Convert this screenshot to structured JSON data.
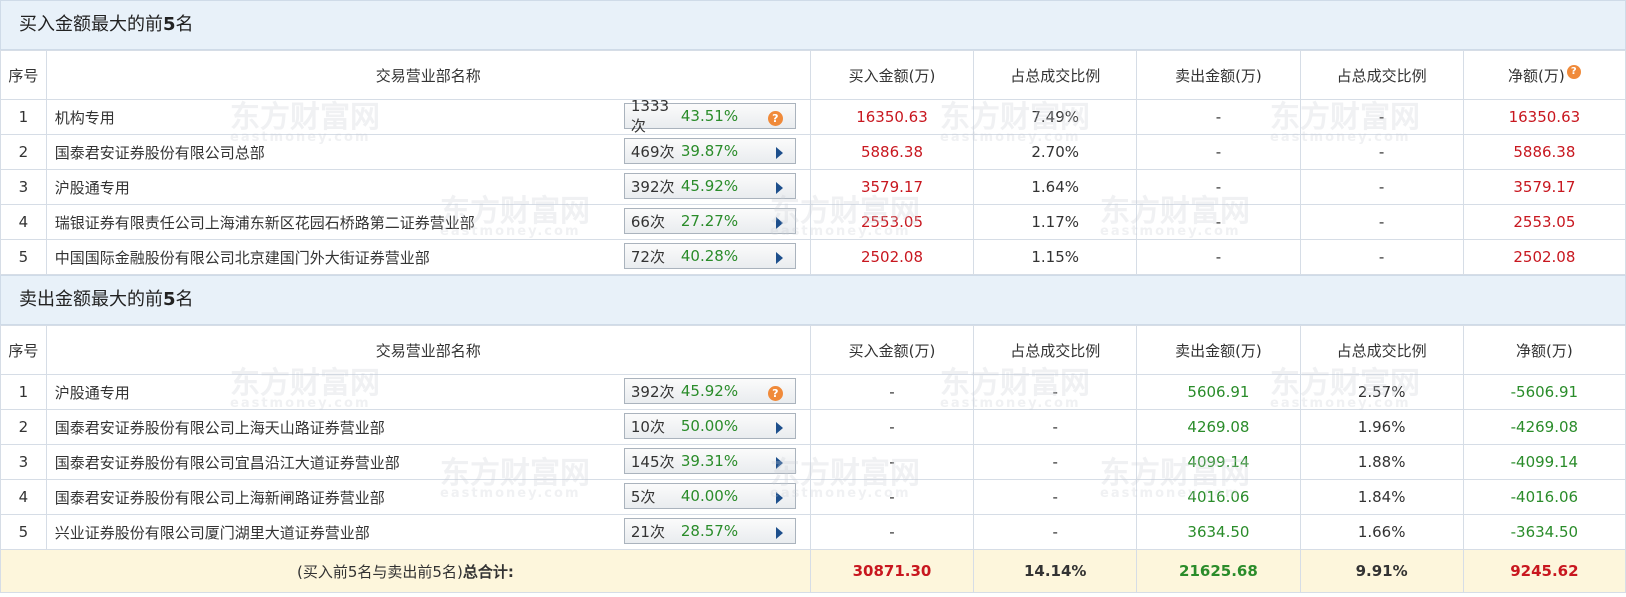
{
  "buy_section": {
    "title_prefix": "买入金额最大的前",
    "title_num": "5",
    "title_suffix": "名",
    "headers": [
      "序号",
      "交易营业部名称",
      "买入金额(万)",
      "占总成交比例",
      "卖出金额(万)",
      "占总成交比例",
      "净额(万)"
    ],
    "rows": [
      {
        "idx": "1",
        "name": "机构专用",
        "count": "1333次",
        "pct": "43.51%",
        "icon": "question-icon",
        "buy": "16350.63",
        "buy_ratio": "7.49%",
        "sell": "-",
        "sell_ratio": "-",
        "net": "16350.63"
      },
      {
        "idx": "2",
        "name": "国泰君安证券股份有限公司总部",
        "count": "469次",
        "pct": "39.87%",
        "icon": "arrow-right-icon",
        "buy": "5886.38",
        "buy_ratio": "2.70%",
        "sell": "-",
        "sell_ratio": "-",
        "net": "5886.38"
      },
      {
        "idx": "3",
        "name": "沪股通专用",
        "count": "392次",
        "pct": "45.92%",
        "icon": "arrow-right-icon",
        "buy": "3579.17",
        "buy_ratio": "1.64%",
        "sell": "-",
        "sell_ratio": "-",
        "net": "3579.17"
      },
      {
        "idx": "4",
        "name": "瑞银证券有限责任公司上海浦东新区花园石桥路第二证券营业部",
        "count": "66次",
        "pct": "27.27%",
        "icon": "arrow-right-icon",
        "buy": "2553.05",
        "buy_ratio": "1.17%",
        "sell": "-",
        "sell_ratio": "-",
        "net": "2553.05"
      },
      {
        "idx": "5",
        "name": "中国国际金融股份有限公司北京建国门外大街证券营业部",
        "count": "72次",
        "pct": "40.28%",
        "icon": "arrow-right-icon",
        "buy": "2502.08",
        "buy_ratio": "1.15%",
        "sell": "-",
        "sell_ratio": "-",
        "net": "2502.08"
      }
    ]
  },
  "sell_section": {
    "title_prefix": "卖出金额最大的前",
    "title_num": "5",
    "title_suffix": "名",
    "headers": [
      "序号",
      "交易营业部名称",
      "买入金额(万)",
      "占总成交比例",
      "卖出金额(万)",
      "占总成交比例",
      "净额(万)"
    ],
    "rows": [
      {
        "idx": "1",
        "name": "沪股通专用",
        "count": "392次",
        "pct": "45.92%",
        "icon": "question-icon",
        "buy": "-",
        "buy_ratio": "-",
        "sell": "5606.91",
        "sell_ratio": "2.57%",
        "net": "-5606.91"
      },
      {
        "idx": "2",
        "name": "国泰君安证券股份有限公司上海天山路证券营业部",
        "count": "10次",
        "pct": "50.00%",
        "icon": "arrow-right-icon",
        "buy": "-",
        "buy_ratio": "-",
        "sell": "4269.08",
        "sell_ratio": "1.96%",
        "net": "-4269.08"
      },
      {
        "idx": "3",
        "name": "国泰君安证券股份有限公司宜昌沿江大道证券营业部",
        "count": "145次",
        "pct": "39.31%",
        "icon": "arrow-right-icon",
        "buy": "-",
        "buy_ratio": "-",
        "sell": "4099.14",
        "sell_ratio": "1.88%",
        "net": "-4099.14"
      },
      {
        "idx": "4",
        "name": "国泰君安证券股份有限公司上海新闸路证券营业部",
        "count": "5次",
        "pct": "40.00%",
        "icon": "arrow-right-icon",
        "buy": "-",
        "buy_ratio": "-",
        "sell": "4016.06",
        "sell_ratio": "1.84%",
        "net": "-4016.06"
      },
      {
        "idx": "5",
        "name": "兴业证券股份有限公司厦门湖里大道证券营业部",
        "count": "21次",
        "pct": "28.57%",
        "icon": "arrow-right-icon",
        "buy": "-",
        "buy_ratio": "-",
        "sell": "3634.50",
        "sell_ratio": "1.66%",
        "net": "-3634.50"
      }
    ]
  },
  "total": {
    "label_prefix": "(买入前5名与卖出前5名)",
    "label_bold": "总合计:",
    "buy": "30871.30",
    "buy_ratio": "14.14%",
    "sell": "21625.68",
    "sell_ratio": "9.91%",
    "net": "9245.62"
  },
  "watermark": {
    "cn": "东方财富网",
    "en": "eastmoney.com"
  },
  "colors": {
    "positive": "#c8171f",
    "negative": "#2a8c2a",
    "header_bg": "#e8f1f9",
    "total_bg": "#fdf6dc"
  }
}
